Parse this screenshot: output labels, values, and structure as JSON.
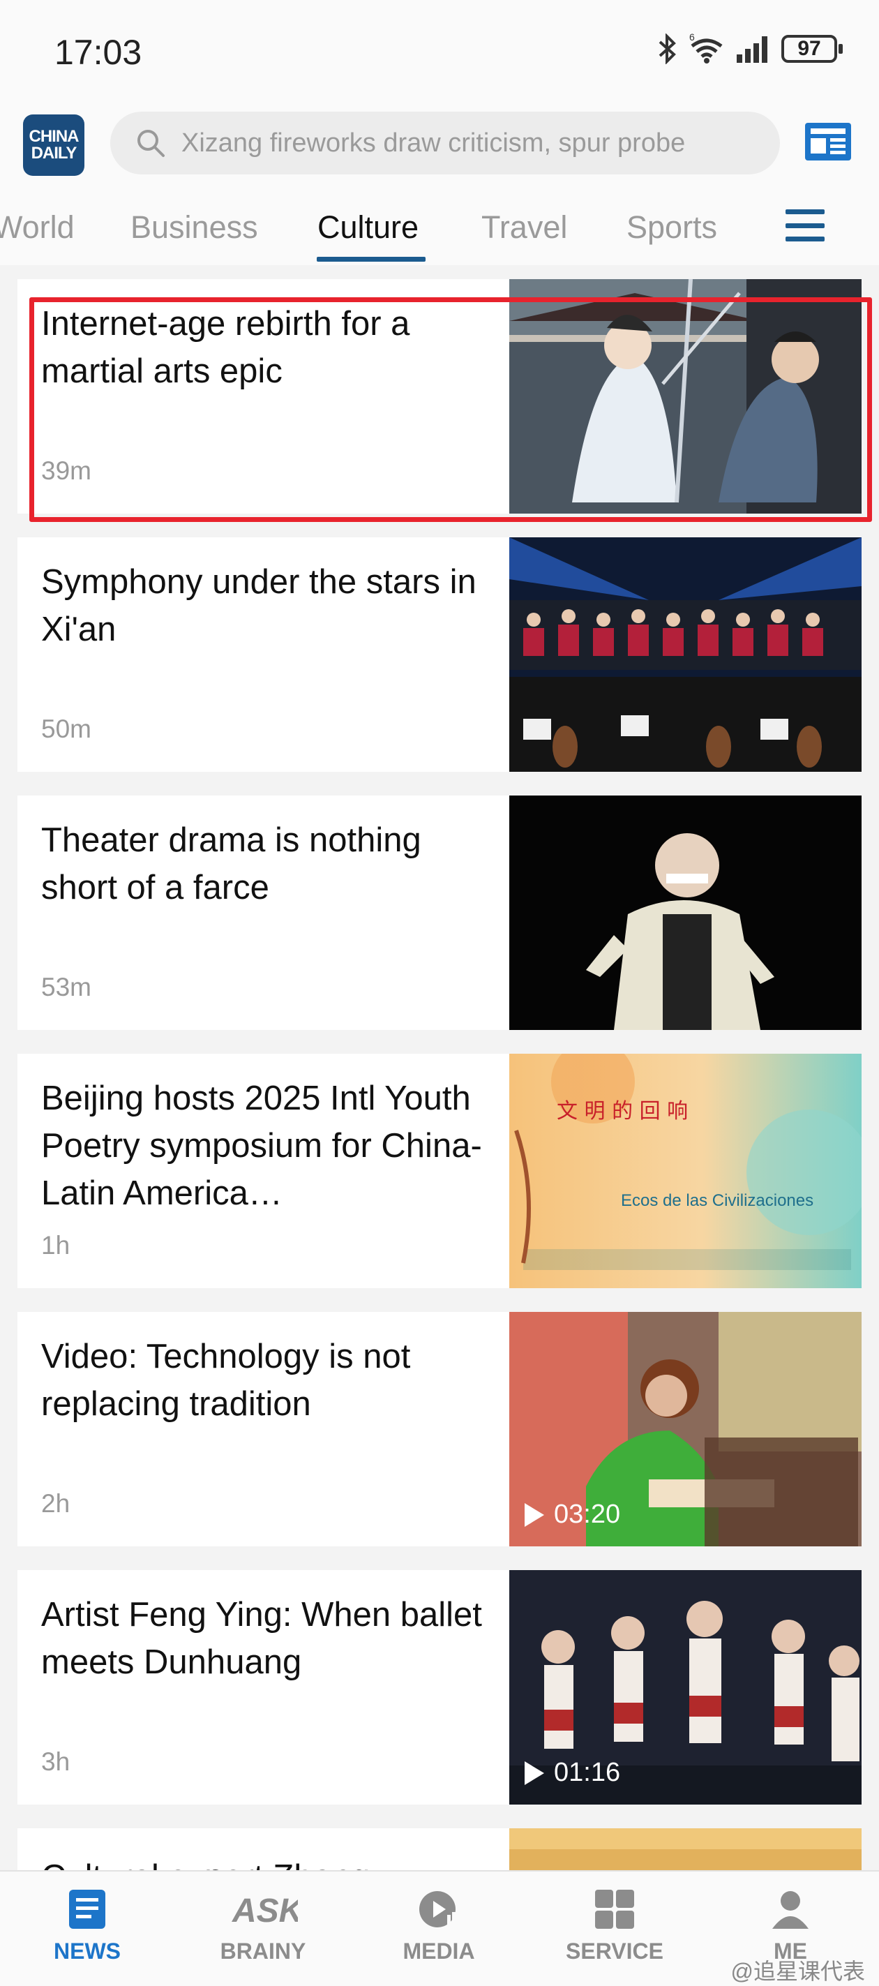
{
  "status_bar": {
    "time": "17:03",
    "battery": "97"
  },
  "header": {
    "logo_line1": "CHINA",
    "logo_line2": "DAILY",
    "search_placeholder": "Xizang fireworks draw criticism, spur probe"
  },
  "tabs": [
    {
      "label": "World"
    },
    {
      "label": "Business"
    },
    {
      "label": "Culture",
      "active": true
    },
    {
      "label": "Travel"
    },
    {
      "label": "Sports"
    }
  ],
  "articles": [
    {
      "title": "Internet-age rebirth for a martial arts epic",
      "time": "39m",
      "highlighted": true
    },
    {
      "title": "Symphony under the stars in Xi'an",
      "time": "50m"
    },
    {
      "title": "Theater drama is nothing short of a farce",
      "time": "53m"
    },
    {
      "title": "Beijing hosts 2025 Intl Youth Poetry symposium for China-Latin America…",
      "time": "1h",
      "thumb_text": {
        "cn_title": "文 明 的 回 响",
        "es_title": "Ecos de las Civilizaciones"
      }
    },
    {
      "title": "Video: Technology is not replacing tradition",
      "time": "2h",
      "video_duration": "03:20"
    },
    {
      "title": "Artist Feng Ying: When ballet meets Dunhuang",
      "time": "3h",
      "video_duration": "01:16"
    },
    {
      "title": "Cultural expert Zhang",
      "time": ""
    }
  ],
  "bottom_nav": [
    {
      "label": "NEWS",
      "active": true
    },
    {
      "label": "BRAINY"
    },
    {
      "label": "MEDIA"
    },
    {
      "label": "SERVICE"
    },
    {
      "label": "ME"
    }
  ],
  "watermark": "@追星课代表",
  "colors": {
    "brand_blue": "#1b5b8f",
    "active_nav": "#1d75c9",
    "highlight_red": "#e8232d"
  }
}
